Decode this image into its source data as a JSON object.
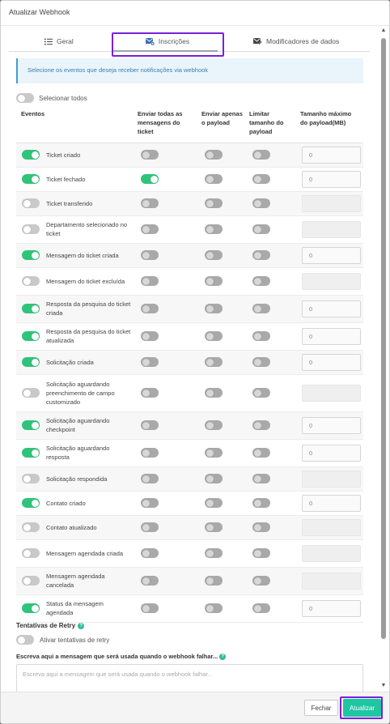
{
  "modal": {
    "title": "Atualizar Webhook"
  },
  "tabs": [
    {
      "label": "Geral",
      "icon": "list-icon"
    },
    {
      "label": "Inscrições",
      "icon": "envelope-plus-icon",
      "active": true
    },
    {
      "label": "Modificadores de dados",
      "icon": "envelope-edit-icon"
    }
  ],
  "info": "Selecione os eventos que deseja receber notificações via webhook",
  "select_all": {
    "label": "Selecionar todos",
    "on": false
  },
  "table": {
    "headers": [
      "Eventos",
      "Enviar todas as mensagens do ticket",
      "Enviar apenas o payload",
      "Limitar tamanho do payload",
      "Tamanho máximo do payload(MB)"
    ],
    "rows": [
      {
        "event": "Ticket criado",
        "enabled": true,
        "all_messages": false,
        "payload_only": false,
        "limit": false,
        "max_size": "0"
      },
      {
        "event": "Ticket fechado",
        "enabled": true,
        "all_messages": true,
        "payload_only": false,
        "limit": false,
        "max_size": "0"
      },
      {
        "event": "Ticket transferido",
        "enabled": false,
        "all_messages": false,
        "payload_only": false,
        "limit": false,
        "max_size": ""
      },
      {
        "event": "Departamento selecionado no ticket",
        "enabled": false,
        "all_messages": false,
        "payload_only": false,
        "limit": false,
        "max_size": ""
      },
      {
        "event": "Mensagem do ticket criada",
        "enabled": true,
        "all_messages": false,
        "payload_only": false,
        "limit": false,
        "max_size": "0"
      },
      {
        "event": "Mensagem do ticket excluída",
        "enabled": false,
        "all_messages": false,
        "payload_only": false,
        "limit": false,
        "max_size": ""
      },
      {
        "event": "Resposta da pesquisa do ticket criada",
        "enabled": true,
        "all_messages": false,
        "payload_only": false,
        "limit": false,
        "max_size": "0"
      },
      {
        "event": "Resposta da pesquisa do ticket atualizada",
        "enabled": true,
        "all_messages": false,
        "payload_only": false,
        "limit": false,
        "max_size": "0"
      },
      {
        "event": "Solicitação criada",
        "enabled": true,
        "all_messages": false,
        "payload_only": false,
        "limit": false,
        "max_size": "0"
      },
      {
        "event": "Solicitação aguardando preenchimento de campo customizado",
        "enabled": false,
        "all_messages": false,
        "payload_only": false,
        "limit": false,
        "max_size": ""
      },
      {
        "event": "Solicitação aguardando checkpoint",
        "enabled": true,
        "all_messages": false,
        "payload_only": false,
        "limit": false,
        "max_size": "0"
      },
      {
        "event": "Solicitação aguardando resposta",
        "enabled": true,
        "all_messages": false,
        "payload_only": false,
        "limit": false,
        "max_size": "0"
      },
      {
        "event": "Solicitação respondida",
        "enabled": false,
        "all_messages": false,
        "payload_only": false,
        "limit": false,
        "max_size": ""
      },
      {
        "event": "Contato criado",
        "enabled": true,
        "all_messages": false,
        "payload_only": false,
        "limit": false,
        "max_size": "0"
      },
      {
        "event": "Contato atualizado",
        "enabled": false,
        "all_messages": false,
        "payload_only": false,
        "limit": false,
        "max_size": ""
      },
      {
        "event": "Mensagem agendada criada",
        "enabled": false,
        "all_messages": false,
        "payload_only": false,
        "limit": false,
        "max_size": ""
      },
      {
        "event": "Mensagem agendada cancelada",
        "enabled": false,
        "all_messages": false,
        "payload_only": false,
        "limit": false,
        "max_size": ""
      },
      {
        "event": "Status da mensagem agendada",
        "enabled": true,
        "all_messages": false,
        "payload_only": false,
        "limit": false,
        "max_size": "0"
      }
    ]
  },
  "retry": {
    "title": "Tentativas de Retry",
    "toggle_label": "Ativar tentativas de retry",
    "on": false
  },
  "message": {
    "label": "Escreva aqui a mensagem que será usada quando o webhook falhar...",
    "placeholder": "Escreva aqui a mensagem que será usada quando o webhook falhar..."
  },
  "footer": {
    "close_label": "Fechar",
    "update_label": "Atualizar"
  },
  "colors": {
    "toggle_on": "#2fc479",
    "toggle_off": "#c9c9c9",
    "primary_button": "#1ec6a2",
    "highlight": "#7a1fdc",
    "info_text": "#3a7fb0"
  }
}
